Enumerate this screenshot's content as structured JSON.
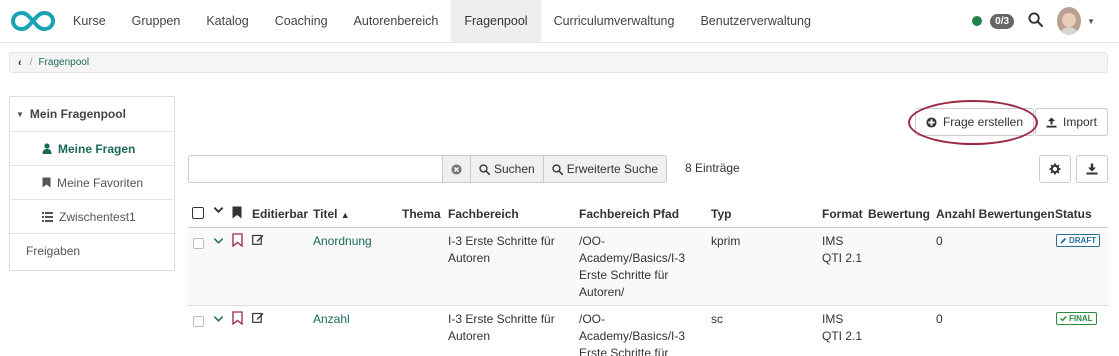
{
  "nav": {
    "items": [
      "Kurse",
      "Gruppen",
      "Katalog",
      "Coaching",
      "Autorenbereich",
      "Fragenpool",
      "Curriculumverwaltung",
      "Benutzerverwaltung"
    ],
    "active_index": 5,
    "badge_count": "0/3",
    "status_color": "#20804a"
  },
  "breadcrumb": {
    "item": "Fragenpool"
  },
  "sidebar": {
    "header": "Mein Fragenpool",
    "items": [
      {
        "label": "Meine Fragen",
        "icon": "user-icon",
        "active": true
      },
      {
        "label": "Meine Favoriten",
        "icon": "bookmark-icon",
        "active": false
      },
      {
        "label": "Zwischentest1",
        "icon": "list-icon",
        "active": false
      }
    ],
    "shares": "Freigaben"
  },
  "toolbar": {
    "create_label": "Frage erstellen",
    "import_label": "Import"
  },
  "search": {
    "placeholder": "",
    "value": "",
    "search_label": "Suchen",
    "advanced_label": "Erweiterte Suche",
    "entries": "8 Einträge"
  },
  "table": {
    "columns": [
      "Editierbar",
      "Titel",
      "Thema",
      "Fachbereich",
      "Fachbereich Pfad",
      "Typ",
      "Format",
      "Bewertung",
      "Anzahl Bewertungen",
      "Status"
    ],
    "sorted_column": "Titel",
    "sort_direction": "ascending",
    "rows": [
      {
        "title": "Anordnung",
        "topic": "",
        "subject_lines": [
          "I-3 Erste Schritte für",
          "Autoren"
        ],
        "path_lines": [
          "/OO-",
          "Academy/Basics/I-3",
          "Erste Schritte für",
          "Autoren/"
        ],
        "type": "kprim",
        "format_lines": [
          "IMS",
          "QTI 2.1"
        ],
        "rating": "",
        "rating_count": "0",
        "status": "DRAFT"
      },
      {
        "title": "Anzahl",
        "topic": "",
        "subject_lines": [
          "I-3 Erste Schritte für",
          "Autoren"
        ],
        "path_lines": [
          "/OO-",
          "Academy/Basics/I-3",
          "Erste Schritte für"
        ],
        "type": "sc",
        "format_lines": [
          "IMS",
          "QTI 2.1"
        ],
        "rating": "",
        "rating_count": "0",
        "status": "FINAL"
      }
    ]
  },
  "colors": {
    "accent": "#1a6a5a",
    "highlight": "#9a2a43",
    "draft": "#2a6f9a",
    "final": "#2b8a3e"
  }
}
